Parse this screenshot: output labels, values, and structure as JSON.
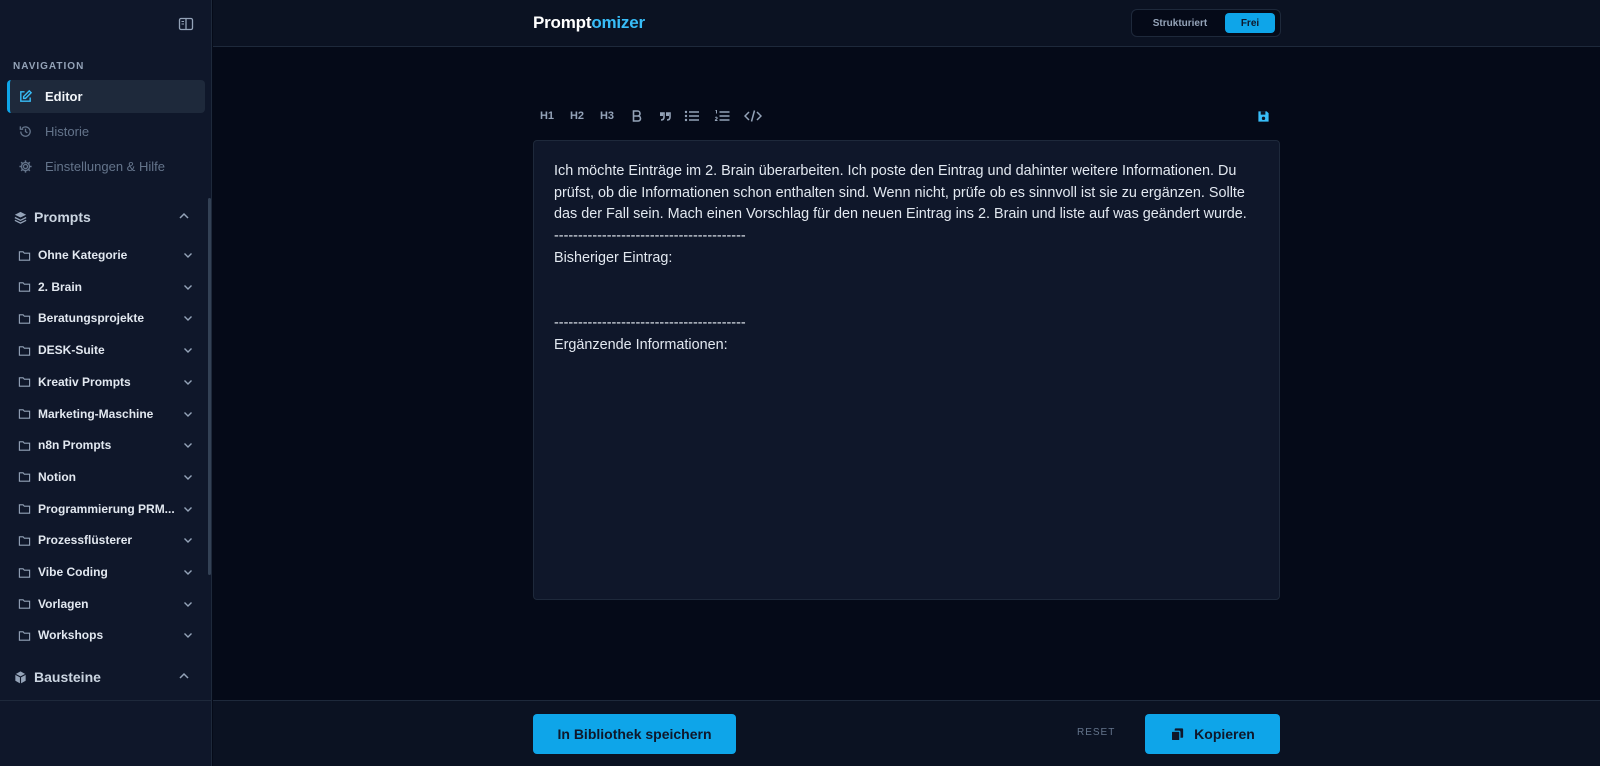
{
  "sidebar": {
    "nav_heading": "NAVIGATION",
    "nav_items": [
      {
        "label": "Editor",
        "icon": "edit-icon",
        "active": true
      },
      {
        "label": "Historie",
        "icon": "history-icon",
        "active": false
      },
      {
        "label": "Einstellungen & Hilfe",
        "icon": "gear-icon",
        "active": false
      }
    ],
    "prompts_section": {
      "label": "Prompts",
      "icon": "layers-icon"
    },
    "folders": [
      {
        "label": "Ohne Kategorie"
      },
      {
        "label": "2. Brain"
      },
      {
        "label": "Beratungsprojekte"
      },
      {
        "label": "DESK-Suite"
      },
      {
        "label": "Kreativ Prompts"
      },
      {
        "label": "Marketing-Maschine"
      },
      {
        "label": "n8n Prompts"
      },
      {
        "label": "Notion"
      },
      {
        "label": "Programmierung PRM..."
      },
      {
        "label": "Prozessflüsterer"
      },
      {
        "label": "Vibe Coding"
      },
      {
        "label": "Vorlagen"
      },
      {
        "label": "Workshops"
      }
    ],
    "bausteine_section": {
      "label": "Bausteine",
      "icon": "box-icon"
    }
  },
  "header": {
    "logo_part1": "Prompt",
    "logo_part2": "omizer",
    "mode_structured": "Strukturiert",
    "mode_free": "Frei",
    "active_mode": "Frei"
  },
  "toolbar": {
    "h1": "H1",
    "h2": "H2",
    "h3": "H3",
    "bold": "B"
  },
  "editor": {
    "lines": [
      "Ich möchte Einträge im 2. Brain überarbeiten. Ich poste den Eintrag und dahinter weitere Informationen. Du",
      "prüfst, ob die Informationen schon enthalten sind. Wenn nicht, prüfe ob es sinnvoll ist sie zu ergänzen. Sollte",
      "das der Fall sein. Mach einen Vorschlag für den neuen Eintrag ins 2. Brain und liste auf was geändert wurde.",
      "----------------------------------------",
      "Bisheriger Eintrag:",
      "",
      "",
      "----------------------------------------",
      "Ergänzende Informationen:"
    ]
  },
  "footer": {
    "save_label": "In Bibliothek speichern",
    "reset_label": "RESET",
    "copy_label": "Kopieren"
  },
  "colors": {
    "accent": "#0ea5e9",
    "background": "#050a18",
    "panel": "#0f172a"
  }
}
